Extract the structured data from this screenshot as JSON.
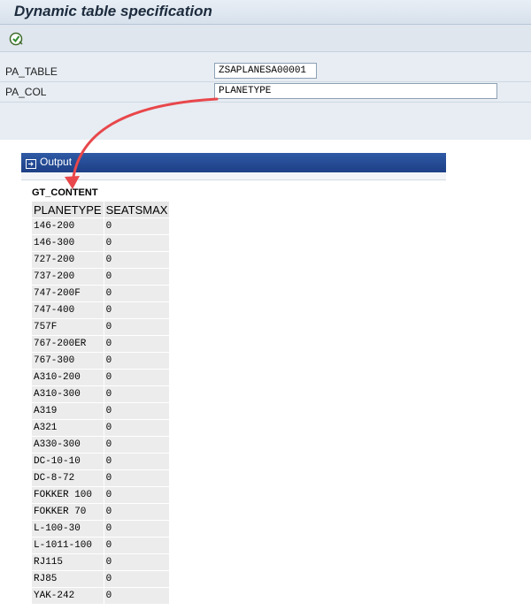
{
  "window": {
    "title": "Dynamic table specification"
  },
  "toolbar": {
    "execute_icon": "execute-icon"
  },
  "form": {
    "fields": [
      {
        "label": "PA_TABLE",
        "value": "ZSAPLANESA00001"
      },
      {
        "label": "PA_COL",
        "value": "PLANETYPE"
      }
    ]
  },
  "output": {
    "title": "Output",
    "table_name": "GT_CONTENT",
    "columns": [
      "PLANETYPE",
      "SEATSMAX"
    ],
    "rows": [
      [
        "146-200",
        "0"
      ],
      [
        "146-300",
        "0"
      ],
      [
        "727-200",
        "0"
      ],
      [
        "737-200",
        "0"
      ],
      [
        "747-200F",
        "0"
      ],
      [
        "747-400",
        "0"
      ],
      [
        "757F",
        "0"
      ],
      [
        "767-200ER",
        "0"
      ],
      [
        "767-300",
        "0"
      ],
      [
        "A310-200",
        "0"
      ],
      [
        "A310-300",
        "0"
      ],
      [
        "A319",
        "0"
      ],
      [
        "A321",
        "0"
      ],
      [
        "A330-300",
        "0"
      ],
      [
        "DC-10-10",
        "0"
      ],
      [
        "DC-8-72",
        "0"
      ],
      [
        "FOKKER 100",
        "0"
      ],
      [
        "FOKKER 70",
        "0"
      ],
      [
        "L-100-30",
        "0"
      ],
      [
        "L-1011-100",
        "0"
      ],
      [
        "RJ115",
        "0"
      ],
      [
        "RJ85",
        "0"
      ],
      [
        "YAK-242",
        "0"
      ]
    ]
  },
  "colors": {
    "header_blue": "#1d3f86",
    "annotation_arrow": "#e8474b"
  }
}
